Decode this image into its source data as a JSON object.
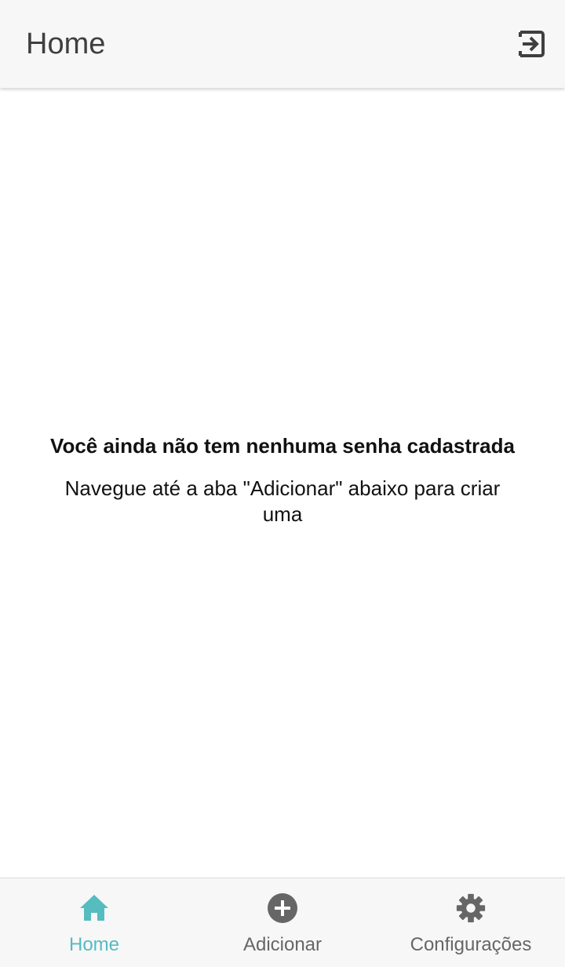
{
  "header": {
    "title": "Home",
    "logout_icon": "logout-icon"
  },
  "empty_state": {
    "title": "Você ainda não tem nenhuma senha cadastrada",
    "subtitle": "Navegue até a aba \"Adicionar\" abaixo para criar uma"
  },
  "bottom_nav": {
    "items": [
      {
        "label": "Home",
        "icon": "home-icon",
        "active": true
      },
      {
        "label": "Adicionar",
        "icon": "add-circle-icon",
        "active": false
      },
      {
        "label": "Configurações",
        "icon": "gear-icon",
        "active": false
      }
    ]
  },
  "colors": {
    "accent": "#55bcc0",
    "inactive": "#666666",
    "header_bg": "#f7f7f7",
    "text": "#111111"
  }
}
